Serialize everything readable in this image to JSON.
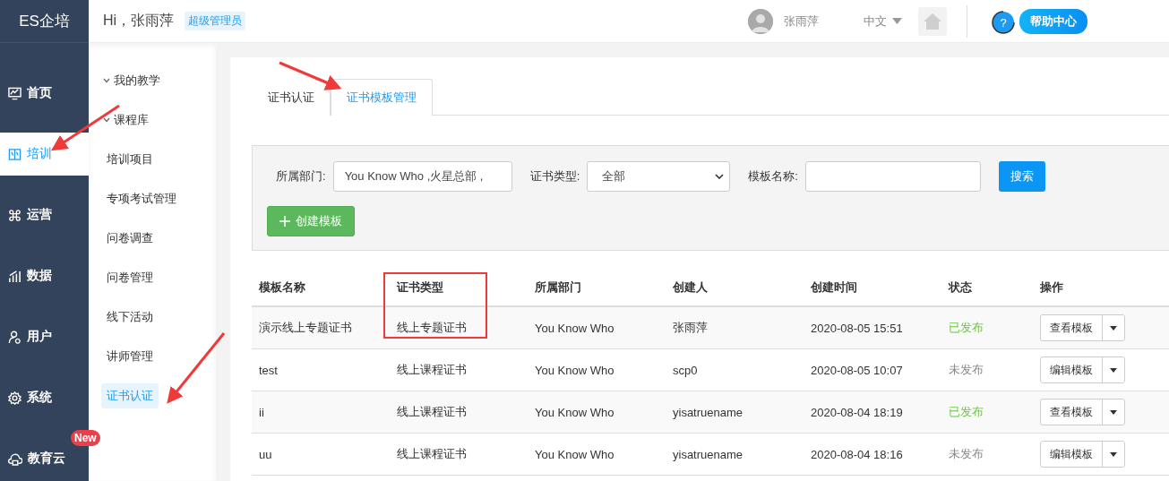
{
  "header": {
    "logo": "ES企培",
    "greeting": "Hi，张雨萍",
    "role_badge": "超级管理员",
    "user_name": "张雨萍",
    "language": "中文",
    "help_icon": "?",
    "help_label": "帮助中心"
  },
  "nav": [
    {
      "label": "首页",
      "selected": false
    },
    {
      "label": "培训",
      "selected": true
    },
    {
      "label": "运营",
      "selected": false
    },
    {
      "label": "数据",
      "selected": false
    },
    {
      "label": "用户",
      "selected": false
    },
    {
      "label": "系统",
      "selected": false
    },
    {
      "label": "教育云",
      "selected": false,
      "badge": "New"
    }
  ],
  "submenu": [
    {
      "label": "我的教学",
      "kind": "group",
      "expanded": true
    },
    {
      "label": "课程库",
      "kind": "group",
      "expanded": true
    },
    {
      "label": "培训项目",
      "kind": "link",
      "selected": false
    },
    {
      "label": "专项考试管理",
      "kind": "link",
      "selected": false
    },
    {
      "label": "问卷调查",
      "kind": "link",
      "selected": false
    },
    {
      "label": "问卷管理",
      "kind": "link",
      "selected": false
    },
    {
      "label": "线下活动",
      "kind": "link",
      "selected": false
    },
    {
      "label": "讲师管理",
      "kind": "link",
      "selected": false
    },
    {
      "label": "证书认证",
      "kind": "link",
      "selected": true
    }
  ],
  "tabs": [
    {
      "label": "证书认证",
      "selected": false
    },
    {
      "label": "证书模板管理",
      "selected": true
    }
  ],
  "filters": {
    "department_label": "所属部门:",
    "department_value": "You Know Who ,火星总部 ,",
    "type_label": "证书类型:",
    "type_value": "全部",
    "name_label": "模板名称:",
    "search_button": "搜索",
    "create_button": "创建模板"
  },
  "table": {
    "columns": [
      "模板名称",
      "证书类型",
      "所属部门",
      "创建人",
      "创建时间",
      "状态",
      "操作"
    ],
    "rows": [
      {
        "name": "演示线上专题证书",
        "type": "线上专题证书",
        "department": "You Know Who",
        "creator": "张雨萍",
        "created": "2020-08-05 15:51",
        "status": "已发布",
        "published": true,
        "action": "查看模板"
      },
      {
        "name": "test",
        "type": "线上课程证书",
        "department": "You Know Who",
        "creator": "scp0",
        "created": "2020-08-05 10:07",
        "status": "未发布",
        "published": false,
        "action": "编辑模板"
      },
      {
        "name": "ii",
        "type": "线上课程证书",
        "department": "You Know Who",
        "creator": "yisatruename",
        "created": "2020-08-04 18:19",
        "status": "已发布",
        "published": true,
        "action": "查看模板"
      },
      {
        "name": "uu",
        "type": "线上课程证书",
        "department": "You Know Who",
        "creator": "yisatruename",
        "created": "2020-08-04 18:16",
        "status": "未发布",
        "published": false,
        "action": "编辑模板"
      }
    ]
  }
}
